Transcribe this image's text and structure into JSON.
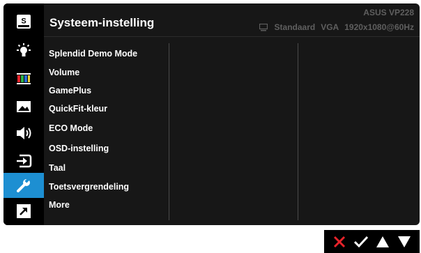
{
  "header": {
    "title": "Systeem-instelling",
    "model": "ASUS  VP228",
    "mode": "Standaard",
    "input": "VGA",
    "resolution": "1920x1080@60Hz"
  },
  "sidebar": {
    "items": [
      {
        "name": "splendid",
        "icon": "s-box-icon"
      },
      {
        "name": "blue-light-filter",
        "icon": "light-bulb-icon"
      },
      {
        "name": "color",
        "icon": "color-bars-icon"
      },
      {
        "name": "image",
        "icon": "landscape-image-icon"
      },
      {
        "name": "sound",
        "icon": "speaker-icon"
      },
      {
        "name": "input-select",
        "icon": "input-source-icon"
      },
      {
        "name": "system-setup",
        "icon": "wrench-icon",
        "active": true
      },
      {
        "name": "shortcut",
        "icon": "shortcut-arrow-icon"
      }
    ]
  },
  "menu": {
    "items": [
      "Splendid Demo Mode",
      "Volume",
      "GamePlus",
      "QuickFit-kleur",
      "ECO Mode",
      "OSD-instelling",
      "Taal",
      "Toetsvergrendeling",
      "More"
    ]
  },
  "colors": {
    "panel": "#171717",
    "sidebar": "#000000",
    "active": "#1d8fd2",
    "cancel": "#e8232a",
    "text": "#ffffff",
    "muted": "#5f5f5f"
  },
  "nav": {
    "buttons": [
      "close-icon",
      "check-icon",
      "arrow-up-icon",
      "arrow-down-icon"
    ]
  }
}
